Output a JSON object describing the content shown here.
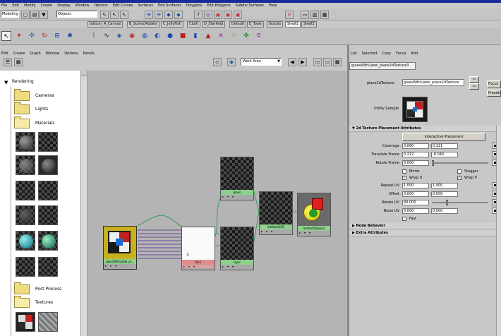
{
  "menu_bar": {
    "items": [
      "File",
      "Edit",
      "Modify",
      "Create",
      "Display",
      "Window",
      "Options",
      "Edit Curves",
      "Surfaces",
      "Edit Surfaces",
      "Polygons",
      "Edit Polygons",
      "Subdiv Surfaces",
      "Help"
    ]
  },
  "status_line": {
    "mode": "Modeling",
    "selection_mask": "Objects"
  },
  "shelf": {
    "tabs": [
      "lattice",
      "A_Canvas",
      "B_ScenicModels",
      "C_JellyFish",
      "Cloth",
      "D_Starfield",
      "Default",
      "E_Tools",
      "Scripts",
      "Shelf1",
      "Shelf2"
    ],
    "active_tab": "Shelf1"
  },
  "hypershade": {
    "menu": [
      "Edit",
      "Create",
      "Graph",
      "Window",
      "Options",
      "Panels"
    ],
    "work_area_label": "Work Area",
    "tree": {
      "root": "Rendering",
      "items": [
        "Cameras",
        "Lights",
        "Materials",
        "Post Process",
        "Textures"
      ]
    },
    "nodes": [
      {
        "label": "glass"
      },
      {
        "label": "lambert2SG"
      },
      {
        "label": "glassWithLabel_pl..."
      },
      {
        "label": "file1"
      },
      {
        "label": "layer"
      },
      {
        "label": "lambertShape1"
      }
    ],
    "file_node_digit": "3"
  },
  "attribute_editor": {
    "menu": [
      "List",
      "Selected",
      "Copy",
      "Focus",
      "Add"
    ],
    "tab": "glassWithLabel_place2dTexture3",
    "node_type_label": "place2dTexture:",
    "node_name": "glassWithLabel_place2dTexture",
    "focus_button": "Focus",
    "preset_button": "Presets",
    "sample_label": "Utility Sample",
    "sections": {
      "placement": "2d Texture Placement Attributes",
      "node_behavior": "Node Behavior",
      "extra": "Extra Attributes"
    },
    "interactive_placement": "Interactive Placement",
    "attributes": {
      "coverage": {
        "label": "Coverage",
        "u": "0.060",
        "v": "0.221"
      },
      "translate_frame": {
        "label": "Translate Frame",
        "u": "0.222",
        "v": "-0.040"
      },
      "rotate_frame": {
        "label": "Rotate Frame",
        "value": "0.000"
      },
      "mirror": "Mirror",
      "stagger": "Stagger",
      "wrap_u": "Wrap U",
      "wrap_v": "Wrap V",
      "repeat_uv": {
        "label": "Repeat UV",
        "u": "1.000",
        "v": "1.000"
      },
      "offset": {
        "label": "Offset",
        "u": "0.000",
        "v": "0.000"
      },
      "rotate_uv": {
        "label": "Rotate UV",
        "value": "90.000"
      },
      "noise_uv": {
        "label": "Noise UV",
        "u": "0.000",
        "v": "0.000"
      },
      "fast": "Fast"
    }
  },
  "colors": {
    "title_bar": "#1a2a9c",
    "panel": "#c8c8c8",
    "node_green": "#8cd08c",
    "node_red": "#e08c8c"
  }
}
